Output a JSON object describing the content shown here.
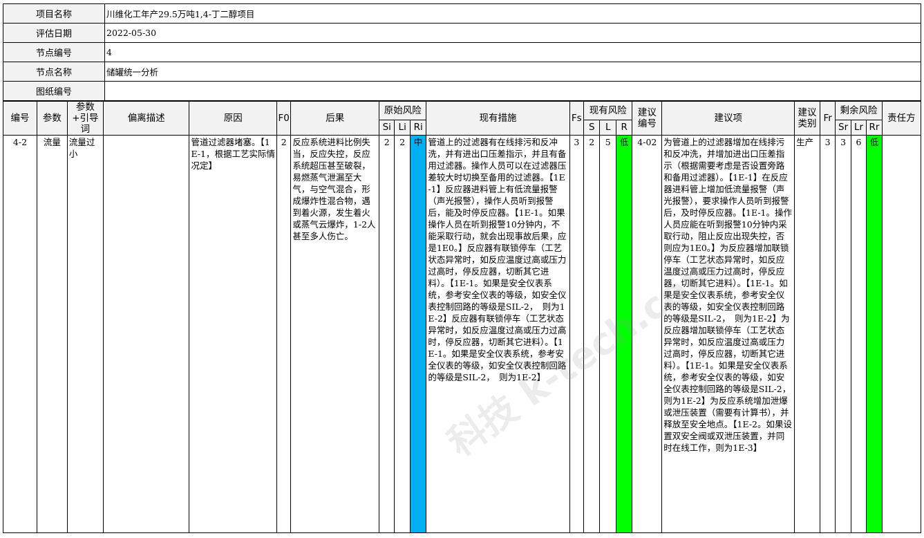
{
  "info": {
    "project_name_label": "项目名称",
    "project_name": "川维化工年产29.5万吨1,4-丁二醇项目",
    "date_label": "评估日期",
    "date": "2022-05-30",
    "node_no_label": "节点编号",
    "node_no": "4",
    "node_name_label": "节点名称",
    "node_name": "储罐统一分析",
    "drawing_label": "图纸编号",
    "drawing": ""
  },
  "headers": {
    "no": "编号",
    "param": "参数",
    "guide": "参数+引导词",
    "deviation": "偏离描述",
    "cause": "原因",
    "f0": "F0",
    "consequence": "后果",
    "orig_risk": "原始风险",
    "si": "Si",
    "li": "Li",
    "ri": "Ri",
    "measures": "现有措施",
    "fs": "Fs",
    "curr_risk": "现有风险",
    "s": "S",
    "l": "L",
    "r": "R",
    "rec_no": "建议编号",
    "rec": "建议项",
    "rec_type": "建议类别",
    "fr": "Fr",
    "res_risk": "剩余风险",
    "sr": "Sr",
    "lr": "Lr",
    "rr": "Rr",
    "owner": "责任方"
  },
  "row": {
    "no": "4-2",
    "param": "流量",
    "guide": "流量过小",
    "deviation": "",
    "cause": "管道过滤器堵塞。【1E-1，根据工艺实际情况定】",
    "f0": "2",
    "consequence": "反应系统进料比例失当，反应失控，反应系统超压甚至破裂，易燃蒸气泄漏至大气，与空气混合，形成爆炸性混合物，遇到着火源，发生着火或蒸气云爆炸，1-2人甚至多人伤亡。",
    "si": "2",
    "li": "2",
    "ri": "中",
    "measures": "管道上的过滤器有在线排污和反冲洗，并有进出口压差指示，并且有备用过滤器。操作人员可以在过滤器压差较大时切换至备用的过滤器。【1E-1】反应器进料管上有低流量报警（声光报警），操作人员听到报警后，能及时停反应器。【1E-1。如果操作人员在听到报警10分钟内，不能采取行动，就会出现事故后果，应是1E0。】反应器有联锁停车（工艺状态异常时，如反应温度过高或压力过高时，停反应器，切断其它进料）。【1E-1。如果是安全仪表系统，参考安全仪表的等级，如安全仪表控制回路的等级是SIL-2，　则为1E-2】反应器有联锁停车（工艺状态异常时，如反应温度过高或压力过高时，停反应器，切断其它进料）。【1E-1。如果是安全仪表系统，参考安全仪表的等级，如安全仪表控制回路的等级是SIL-2，　则为1E-2】",
    "fs": "3",
    "s": "2",
    "l": "5",
    "r": "低",
    "rec_no": "4-02",
    "rec": "为管道上的过滤器增加在线排污和反冲洗，并增加进出口压差指示（根据需要考虑是否设置旁路和备用过滤器）。【1E-1】在反应器进料管上增加低流量报警（声光报警），要求操作人员听到报警后，及时停反应器。【1E-1。操作人员应能在听到报警10分钟内采取行动，阻止反应出现失控，否则应为1E0。】为反应器增加联锁停车（工艺状态异常时，如反应温度过高或压力过高时，停反应器，切断其它进料）。【1E-1。如果是安全仪表系统，参考安全仪表的等级，如安全仪表控制回路的等级是SIL-2，　则为1E-2】为反应器增加联锁停车（工艺状态异常时，如反应温度过高或压力过高时，停反应器，切断其它进料）。【1E-1。如果是安全仪表系统，参考安全仪表的等级，如安全仪表控制回路的等级是SIL-2，　则为1E-2】为反应系统增加泄爆或泄压装置（需要有计算书），并释放至安全地点。【1E-2。如果设置双安全阀或双泄压装置，并同时在线工作，则为1E-3】",
    "rec_type": "生产",
    "fr": "3",
    "sr": "3",
    "lr": "6",
    "rr": "低",
    "owner": ""
  },
  "colors": {
    "ri_medium": "#00b0f0",
    "low": "#00ff00",
    "header_bg": "#f2f2f2"
  },
  "watermark": "科技 k-tech.com"
}
